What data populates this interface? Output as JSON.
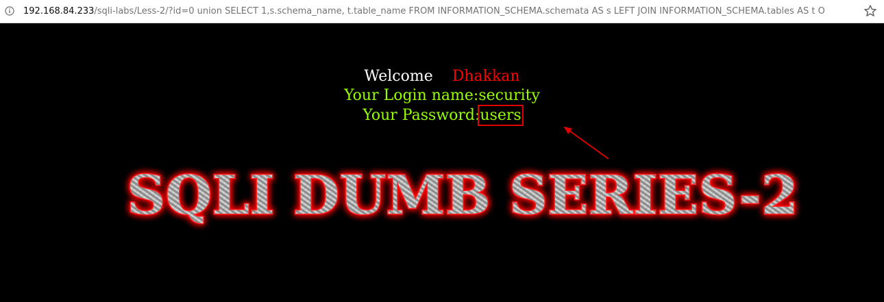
{
  "browser": {
    "url_host": "192.168.84.233",
    "url_path": "/sqli-labs/Less-2/?id=0 union SELECT 1,s.schema_name, t.table_name FROM INFORMATION_SCHEMA.schemata AS s LEFT JOIN INFORMATION_SCHEMA.tables AS t O",
    "info_icon": "info-icon",
    "bookmark_icon": "star-icon"
  },
  "page": {
    "welcome_label": "Welcome",
    "welcome_name": "Dhakkan",
    "login_label": "Your Login name:",
    "login_value": "security",
    "password_label": "Your Password:",
    "password_value": "users",
    "banner_text": "SQLI DUMB SERIES-2"
  },
  "colors": {
    "background": "#000000",
    "welcome_label": "#ffffff",
    "welcome_name": "#ff0000",
    "login_text": "#99ff00",
    "annotation": "#e00000",
    "banner_glow": "#ff0000"
  }
}
